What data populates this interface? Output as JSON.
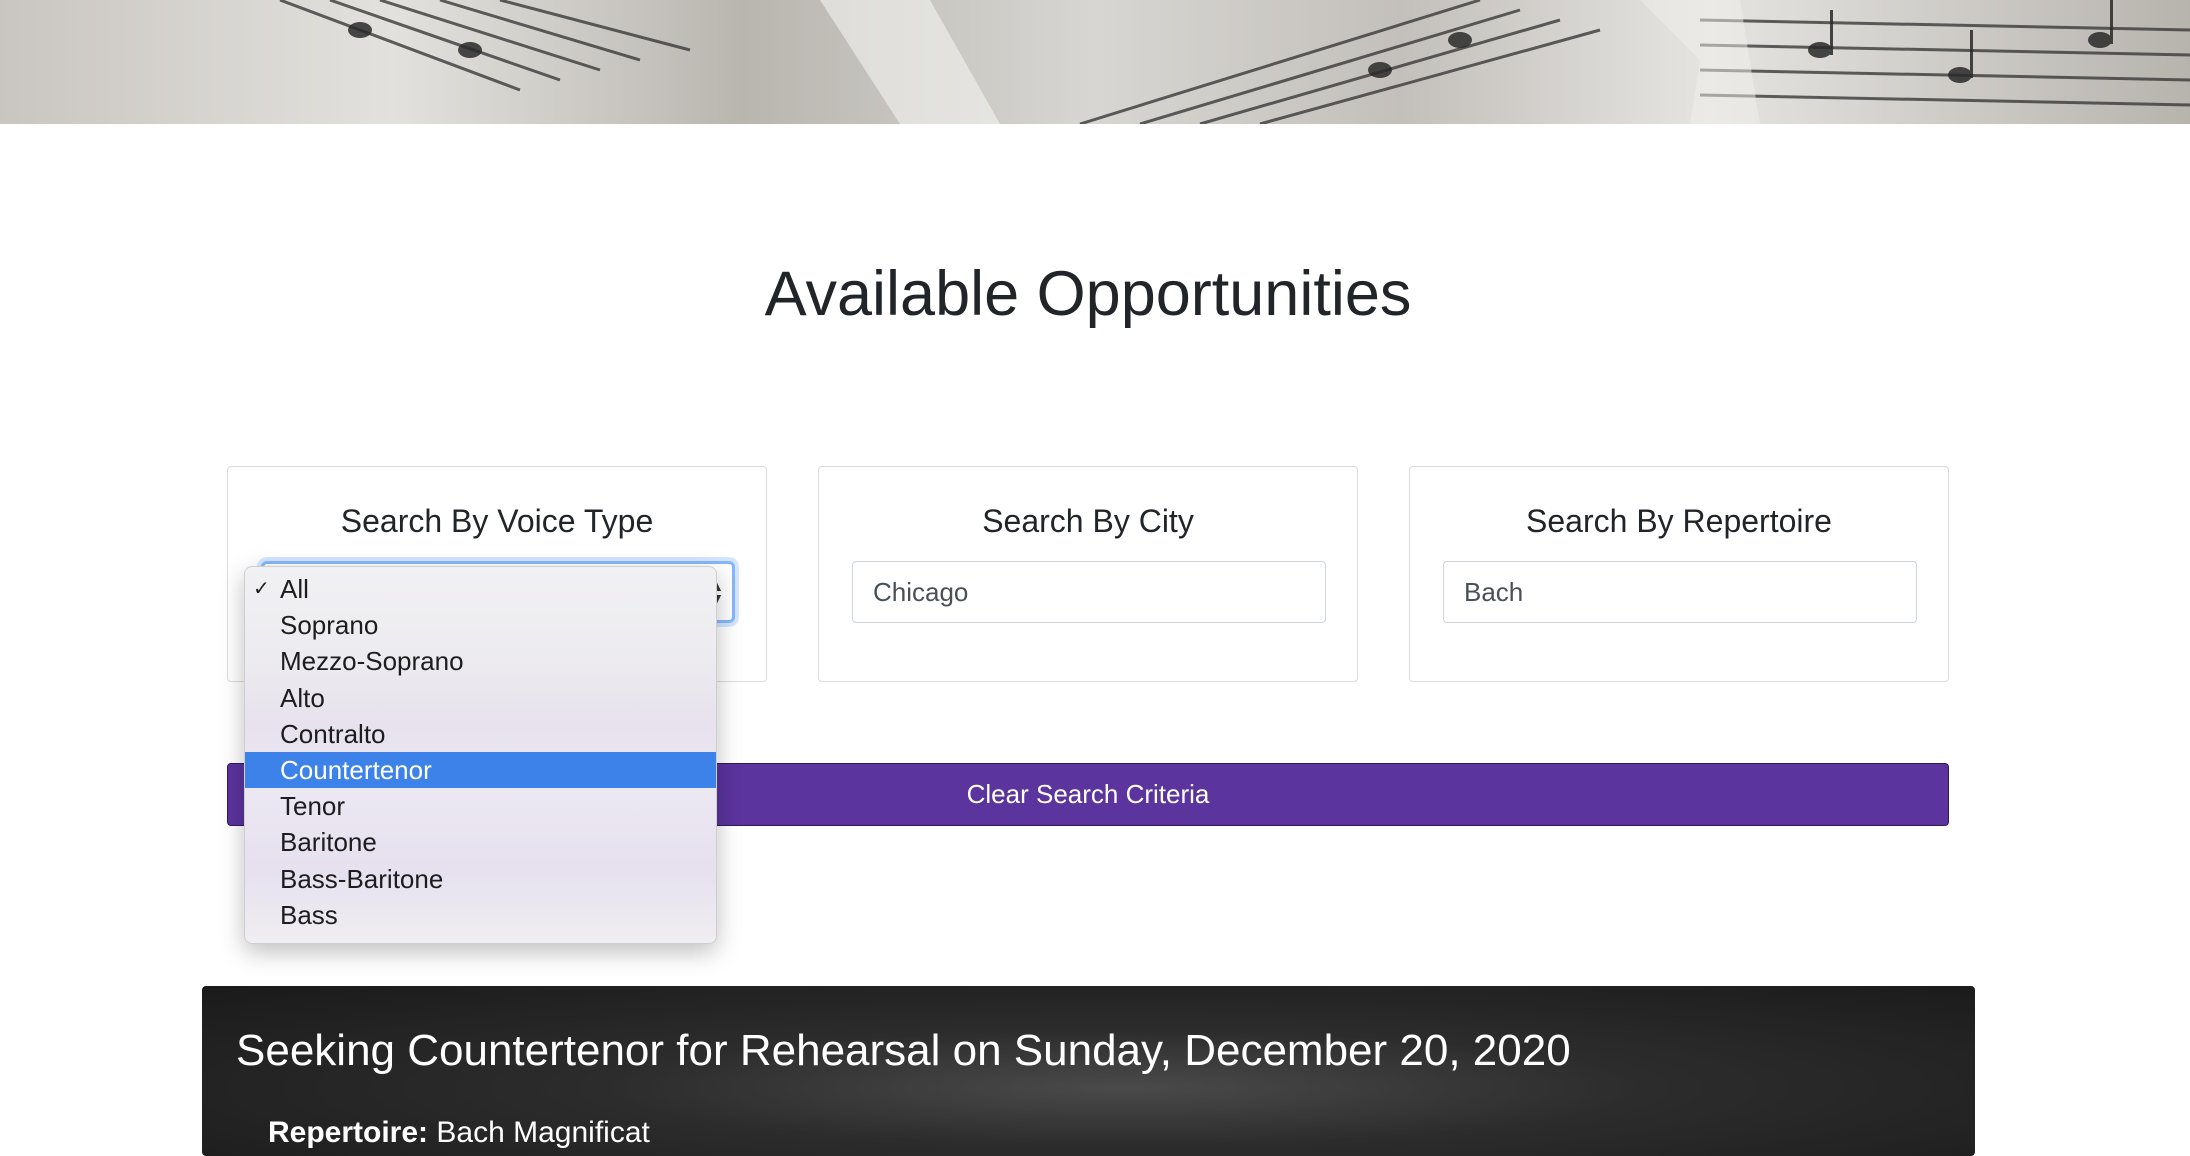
{
  "page": {
    "title": "Available Opportunities"
  },
  "search": {
    "voice": {
      "heading": "Search By Voice Type",
      "selected": "All",
      "options": [
        "All",
        "Soprano",
        "Mezzo-Soprano",
        "Alto",
        "Contralto",
        "Countertenor",
        "Tenor",
        "Baritone",
        "Bass-Baritone",
        "Bass"
      ],
      "highlighted": "Countertenor"
    },
    "city": {
      "heading": "Search By City",
      "value": "Chicago"
    },
    "repertoire": {
      "heading": "Search By Repertoire",
      "value": "Bach"
    },
    "clear_label": "Clear Search Criteria"
  },
  "opportunity": {
    "title": "Seeking Countertenor for Rehearsal on Sunday, December 20, 2020",
    "repertoire_label": "Repertoire:",
    "repertoire_value": "Bach Magnificat"
  },
  "colors": {
    "button_bg": "#5b349e",
    "highlight": "#3d82e8",
    "card_bg": "#2c2c2c"
  }
}
